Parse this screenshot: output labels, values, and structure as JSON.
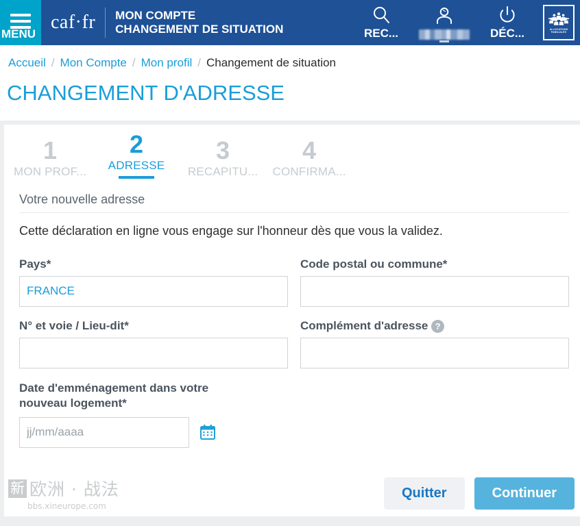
{
  "header": {
    "menu_label": "MENU",
    "menu_icon": "hamburger-icon",
    "brand": "caf·fr",
    "title_line1": "MON COMPTE",
    "title_line2": "CHANGEMENT DE SITUATION",
    "actions": [
      {
        "label": "REC...",
        "icon": "search-icon",
        "name": "search"
      },
      {
        "label": "",
        "icon": "user-icon",
        "name": "account"
      },
      {
        "label": "DÉC...",
        "icon": "power-icon",
        "name": "logout"
      }
    ],
    "logo": {
      "name": "caf-allocations-familiales-logo",
      "text": "ALLOCATIONS FAMILIALES"
    },
    "colors": {
      "header_bg": "#1e5196",
      "menu_bg": "#00a3ca",
      "accent": "#1a9dd9"
    }
  },
  "breadcrumb": {
    "separator": "/",
    "items": [
      {
        "label": "Accueil",
        "current": false
      },
      {
        "label": "Mon Compte",
        "current": false
      },
      {
        "label": "Mon profil",
        "current": false
      },
      {
        "label": "Changement de situation",
        "current": true
      }
    ]
  },
  "page": {
    "title": "CHANGEMENT D'ADRESSE"
  },
  "stepper": {
    "steps": [
      {
        "number": "1",
        "name": "MON PROF...",
        "active": false
      },
      {
        "number": "2",
        "name": "ADRESSE",
        "active": true
      },
      {
        "number": "3",
        "name": "RECAPITU...",
        "active": false
      },
      {
        "number": "4",
        "name": "CONFIRMA...",
        "active": false
      }
    ]
  },
  "form": {
    "section_title": "Votre nouvelle adresse",
    "intro": "Cette déclaration en ligne vous engage sur l'honneur dès que vous la validez.",
    "fields": {
      "pays": {
        "label": "Pays*",
        "value": "FRANCE",
        "placeholder": ""
      },
      "code_postal": {
        "label": "Code postal ou commune*",
        "value": "",
        "placeholder": ""
      },
      "voie": {
        "label": "N° et voie / Lieu-dit*",
        "value": "",
        "placeholder": ""
      },
      "complement": {
        "label": "Complément d'adresse",
        "value": "",
        "placeholder": "",
        "help_icon": "help-question-icon"
      },
      "date_emmenagement": {
        "label": "Date d'emménagement dans votre nouveau logement*",
        "value": "",
        "placeholder": "jj/mm/aaaa",
        "calendar_icon": "calendar-icon"
      }
    }
  },
  "buttons": {
    "quitter": "Quitter",
    "continuer": "Continuer"
  },
  "watermark": {
    "badge": "新",
    "text": "欧洲 · 战法",
    "url": "bbs.xineurope.com"
  }
}
